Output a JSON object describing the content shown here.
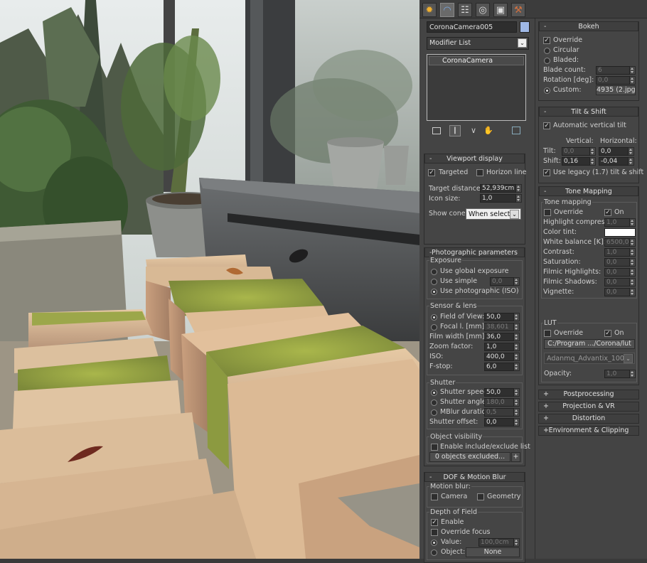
{
  "tabs": [
    {
      "name": "create-tab",
      "icon": "sun-icon",
      "color": "#f0b030"
    },
    {
      "name": "modify-tab",
      "icon": "modify-arc-icon",
      "color": "#7aa7e0"
    },
    {
      "name": "hierarchy-tab",
      "icon": "hierarchy-icon",
      "color": "#ddd"
    },
    {
      "name": "motion-tab",
      "icon": "motion-icon",
      "color": "#ddd"
    },
    {
      "name": "display-tab",
      "icon": "display-icon",
      "color": "#ddd"
    },
    {
      "name": "utilities-tab",
      "icon": "hammer-icon",
      "color": "#d07040"
    }
  ],
  "object": {
    "name": "CoronaCamera005",
    "color": "#9fb8e6"
  },
  "modifier_list": "Modifier List",
  "stack": {
    "item": "CoronaCamera"
  },
  "stack_tools": [
    "pin-stack-icon",
    "show-end-result-icon",
    "make-unique-icon",
    "remove-modifier-icon",
    "configure-sets-icon"
  ],
  "viewport_display": {
    "title": "Viewport display",
    "targeted": "Targeted",
    "horizon_line": "Horizon line",
    "target_distance_label": "Target distance:",
    "target_distance": "52,939cm",
    "icon_size_label": "Icon size:",
    "icon_size": "1,0",
    "show_cone_label": "Show cone:",
    "show_cone": "When selected"
  },
  "photographic": {
    "title": "Photographic parameters",
    "exposure": {
      "label": "Exposure",
      "global": "Use global exposure",
      "simple": "Use simple",
      "simple_value": "0,0",
      "photo": "Use photographic (ISO)"
    },
    "sensor": {
      "label": "Sensor & lens",
      "fov_label": "Field of View:",
      "fov": "50,0",
      "focal_label": "Focal l. [mm]:",
      "focal": "38,601",
      "film_label": "Film width [mm]:",
      "film": "36,0",
      "zoom_label": "Zoom factor:",
      "zoom": "1,0",
      "iso_label": "ISO:",
      "iso": "400,0",
      "fstop_label": "F-stop:",
      "fstop": "6,0"
    },
    "shutter": {
      "label": "Shutter",
      "speed_label": "Shutter speed:",
      "speed": "50,0",
      "angle_label": "Shutter angle:",
      "angle": "180,0",
      "mblur_label": "MBlur duration:",
      "mblur": "0,5",
      "offset_label": "Shutter offset:",
      "offset": "0,0"
    },
    "visibility": {
      "label": "Object visibility",
      "enable": "Enable include/exclude list",
      "excluded": "0 objects excluded...",
      "plus": "+"
    }
  },
  "dof": {
    "title": "DOF & Motion Blur",
    "motion": {
      "label": "Motion blur:",
      "camera": "Camera",
      "geometry": "Geometry"
    },
    "depth": {
      "label": "Depth of Field",
      "enable": "Enable",
      "override": "Override focus",
      "value_label": "Value:",
      "value": "100,0cm",
      "object_label": "Object:",
      "object": "None"
    }
  },
  "bokeh": {
    "title": "Bokeh",
    "override": "Override",
    "circular": "Circular",
    "bladed": "Bladed:",
    "blade_count_label": "Blade count:",
    "blade_count": "6",
    "rotation_label": "Rotation [deg]:",
    "rotation": "0,0",
    "custom_label": "Custom:",
    "custom": "4935 (2.jpg)"
  },
  "tilt": {
    "title": "Tilt & Shift",
    "auto": "Automatic vertical tilt",
    "vertical": "Vertical:",
    "horizontal": "Horizontal:",
    "tilt_label": "Tilt:",
    "tilt_v": "0,0",
    "tilt_h": "0,0",
    "shift_label": "Shift:",
    "shift_v": "0,16",
    "shift_h": "-0,04",
    "legacy": "Use legacy (1.7) tilt & shift"
  },
  "tone": {
    "title": "Tone Mapping",
    "label": "Tone mapping",
    "override": "Override",
    "on": "On",
    "highlight_label": "Highlight compress:",
    "highlight": "1,0",
    "tint_label": "Color tint:",
    "tint_color": "#ffffff",
    "wb_label": "White balance [K]:",
    "wb": "6500,0",
    "contrast_label": "Contrast:",
    "contrast": "1,0",
    "saturation_label": "Saturation:",
    "saturation": "0,0",
    "filmic_h_label": "Filmic Highlights:",
    "filmic_h": "0,0",
    "filmic_s_label": "Filmic Shadows:",
    "filmic_s": "0,0",
    "vignette_label": "Vignette:",
    "vignette": "0,0"
  },
  "lut": {
    "label": "LUT",
    "override": "Override",
    "on": "On",
    "path": "C:/Program .../Corona/lut",
    "preset": "Adanmq_Advantix_100",
    "opacity_label": "Opacity:",
    "opacity": "1,0"
  },
  "collapsed": [
    {
      "name": "rollout-postprocessing",
      "label": "Postprocessing"
    },
    {
      "name": "rollout-projection-vr",
      "label": "Projection & VR"
    },
    {
      "name": "rollout-distortion",
      "label": "Distortion"
    },
    {
      "name": "rollout-environment-clipping",
      "label": "Environment & Clipping"
    }
  ]
}
